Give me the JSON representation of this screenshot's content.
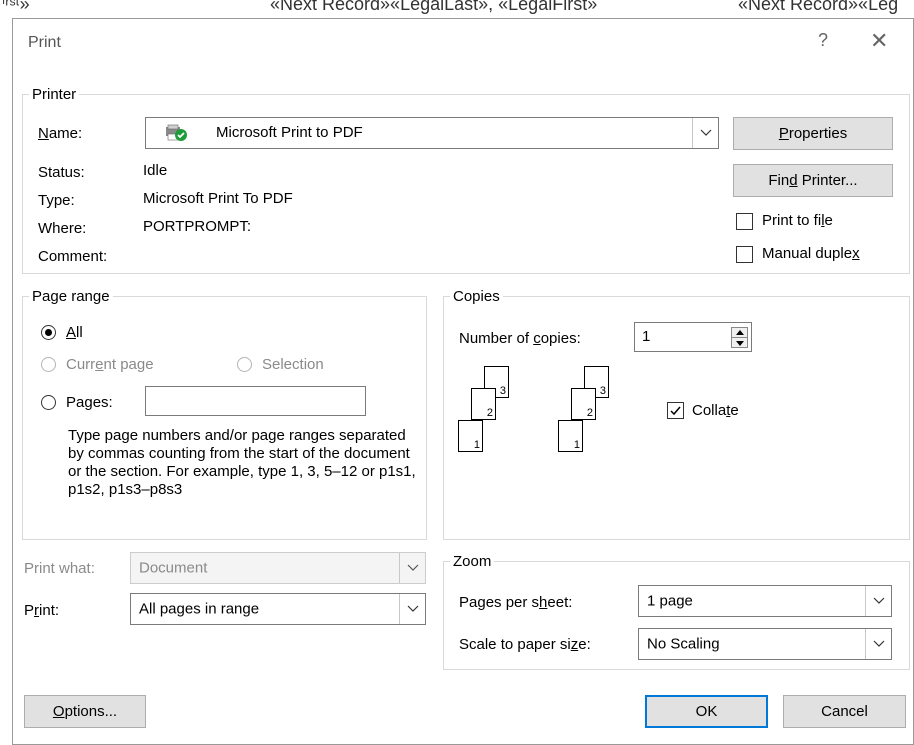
{
  "background": {
    "left_text": "ⁱʳˢᵗ» ",
    "mid_text": "«Next Record»«LegalLast», «LegalFirst»",
    "right_text": "«Next Record»«Leg"
  },
  "dialog": {
    "title": "Print",
    "help_glyph": "?",
    "close_glyph": "✕"
  },
  "printer": {
    "group_label": "Printer",
    "name_label": "Name:",
    "name_value": "Microsoft Print to PDF",
    "status_label": "Status:",
    "status_value": "Idle",
    "type_label": "Type:",
    "type_value": "Microsoft Print To PDF",
    "where_label": "Where:",
    "where_value": "PORTPROMPT:",
    "comment_label": "Comment:",
    "properties_button": "Properties",
    "find_printer_button": "Find Printer...",
    "print_to_file_label": "Print to file",
    "print_to_file_checked": false,
    "manual_duplex_label": "Manual duplex",
    "manual_duplex_checked": false,
    "printer_icon": "printer-ready-icon"
  },
  "page_range": {
    "group_label": "Page range",
    "all_label": "All",
    "current_page_label": "Current page",
    "selection_label": "Selection",
    "pages_label": "Pages:",
    "pages_value": "",
    "selected": "All",
    "help_text": "Type page numbers and/or page ranges separated by commas counting from the start of the document or the section. For example, type 1, 3, 5–12 or p1s1, p1s2, p1s3–p8s3"
  },
  "copies": {
    "group_label": "Copies",
    "number_label": "Number of copies:",
    "number_value": "1",
    "collate_label": "Collate",
    "collate_checked": true,
    "stack_pages": [
      "3",
      "2",
      "1"
    ]
  },
  "print_what": {
    "label": "Print what:",
    "value": "Document"
  },
  "print": {
    "label": "Print:",
    "value": "All pages in range"
  },
  "zoom": {
    "group_label": "Zoom",
    "pages_per_sheet_label": "Pages per sheet:",
    "pages_per_sheet_value": "1 page",
    "scale_label": "Scale to paper size:",
    "scale_value": "No Scaling"
  },
  "footer": {
    "options_button": "Options...",
    "ok_button": "OK",
    "cancel_button": "Cancel"
  },
  "colors": {
    "accent": "#0078d7",
    "button_bg": "#e1e1e1",
    "disabled_text": "#8a8a8a"
  }
}
